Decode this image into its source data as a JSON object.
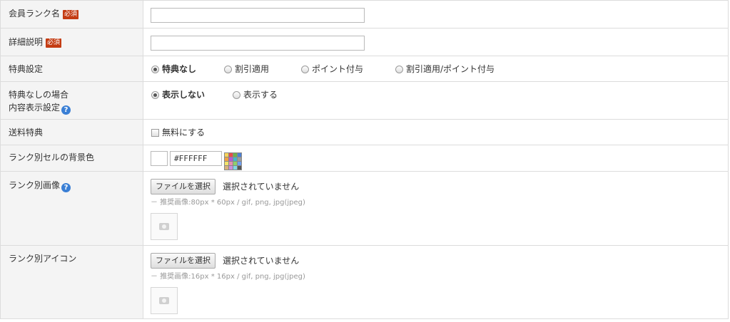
{
  "required_badge": "必須",
  "help_glyph": "?",
  "rows": {
    "rank_name": {
      "label": "会員ランク名",
      "value": ""
    },
    "description": {
      "label": "詳細説明",
      "value": ""
    },
    "benefit": {
      "label": "特典設定",
      "options": [
        "特典なし",
        "割引適用",
        "ポイント付与",
        "割引適用/ポイント付与"
      ],
      "selected": "特典なし"
    },
    "no_benefit_display": {
      "label_line1": "特典なしの場合",
      "label_line2": "内容表示設定",
      "options": [
        "表示しない",
        "表示する"
      ],
      "selected": "表示しない"
    },
    "shipping": {
      "label": "送料特典",
      "checkbox_label": "無料にする",
      "checked": false
    },
    "cell_bg": {
      "label": "ランク別セルの背景色",
      "color_value": "#FFFFFF",
      "palette_colors": [
        "#f7d35a",
        "#e84b4b",
        "#6fb04a",
        "#4a7fd6",
        "#f0a340",
        "#b35ad6",
        "#42b8c9",
        "#9c9c9c",
        "#f2e36b",
        "#e68fb0",
        "#8fd06b",
        "#6f9ff0",
        "#d9b27a",
        "#c98fe0",
        "#7fd9e6",
        "#555555"
      ]
    },
    "rank_image": {
      "label": "ランク別画像",
      "button": "ファイルを選択",
      "status": "選択されていません",
      "hint": "－ 推奨画像:80px * 60px / gif, png, jpg(jpeg)"
    },
    "rank_icon": {
      "label": "ランク別アイコン",
      "button": "ファイルを選択",
      "status": "選択されていません",
      "hint": "－ 推奨画像:16px * 16px / gif, png, jpg(jpeg)"
    }
  }
}
